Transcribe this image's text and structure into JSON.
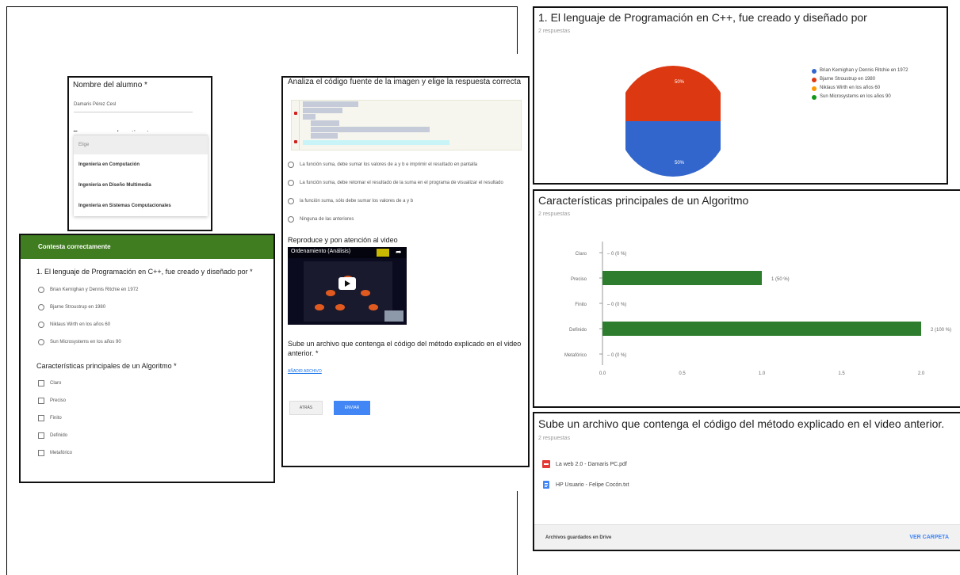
{
  "panel_name": {
    "title": "Nombre del alumno *",
    "value": "Damaris Pérez Cesl",
    "dropdown_title": "Programa educativo *",
    "options": [
      "Elige",
      "Ingeniería en Computación",
      "Ingeniería en Diseño Multimedia",
      "Ingeniería en Sistemas Computacionales"
    ]
  },
  "panel_quiz": {
    "header": "Contesta correctamente",
    "q1": "1. El lenguaje de Programación en C++, fue creado y diseñado por *",
    "q1_options": [
      "Brian Kernighan y Dennis Ritchie en 1972",
      "Bjarne Stroustrup en 1980",
      "Niklaus Wirth en los años 60",
      "Sun Microsystems en los años 90"
    ],
    "q2": "Características principales de un Algoritmo *",
    "q2_options": [
      "Claro",
      "Preciso",
      "Finito",
      "Definido",
      "Metafórico"
    ]
  },
  "panel_code": {
    "title": "Analiza el código fuente de la imagen y elige la respuesta correcta",
    "options": [
      "La función suma, debe sumar los valores de a y b e imprimir el resultado en pantalla",
      "La función suma, debe retornar el resultado de la suma en el programa de visualizar el resultado",
      "la función suma, sólo debe sumar los valores de a y b",
      "Ninguna de las anteriores"
    ],
    "video_section": "Reproduce y pon atención al video",
    "video_title": "Ordenamiento (Análisis)",
    "upload_q": "Sube un archivo que contenga el código del método explicado en el video anterior. *",
    "add_file": "AÑADIR ARCHIVO",
    "back_btn": "ATRÁS",
    "send_btn": "ENVIAR"
  },
  "panel_pie": {
    "title": "1. El lenguaje de Programación en C++, fue creado y diseñado por",
    "subtitle": "2 respuestas",
    "slice_top_label": "50%",
    "slice_bottom_label": "50%"
  },
  "panel_bar": {
    "title": "Características principales de un Algoritmo",
    "subtitle": "2 respuestas"
  },
  "panel_files": {
    "title": "Sube un archivo que contenga el código del método explicado en el video anterior.",
    "subtitle": "2 respuestas",
    "files": [
      "La web 2.0 - Damaris PC.pdf",
      "HP Usuario - Felipe Cocón.txt"
    ],
    "footer_left": "Archivos guardados en Drive",
    "footer_right": "VER CARPETA"
  },
  "colors": {
    "green": "#3f7d20",
    "bar_green": "#2e7d2e",
    "pie_red": "#dc3912",
    "pie_blue": "#3366cc",
    "pie_orange": "#ff9900",
    "pie_green": "#109618"
  },
  "icons": [
    "pdf-file-icon",
    "doc-file-icon",
    "play-icon",
    "share-icon"
  ],
  "chart_data": [
    {
      "type": "pie",
      "labels": [
        "Brian Kernighan y Dennis Ritchie en 1972",
        "Bjarne Stroustrup en 1980",
        "Niklaus Wirth en los años 60",
        "Sun Microsystems en los años 90"
      ],
      "values": [
        1,
        1,
        0,
        0
      ],
      "colors": [
        "#3366cc",
        "#dc3912",
        "#ff9900",
        "#109618"
      ],
      "data_labels": [
        "50%",
        "50%"
      ],
      "legend": "right"
    },
    {
      "type": "bar",
      "orientation": "horizontal",
      "categories": [
        "Claro",
        "Preciso",
        "Finito",
        "Definido",
        "Metafórico"
      ],
      "values": [
        0,
        1,
        0,
        2,
        0
      ],
      "value_labels": [
        "0 (0 %)",
        "1 (50 %)",
        "0 (0 %)",
        "2 (100 %)",
        "0 (0 %)"
      ],
      "xticks": [
        "0.0",
        "0.5",
        "1.0",
        "1.5",
        "2.0"
      ],
      "xlim": [
        0,
        2
      ]
    }
  ]
}
